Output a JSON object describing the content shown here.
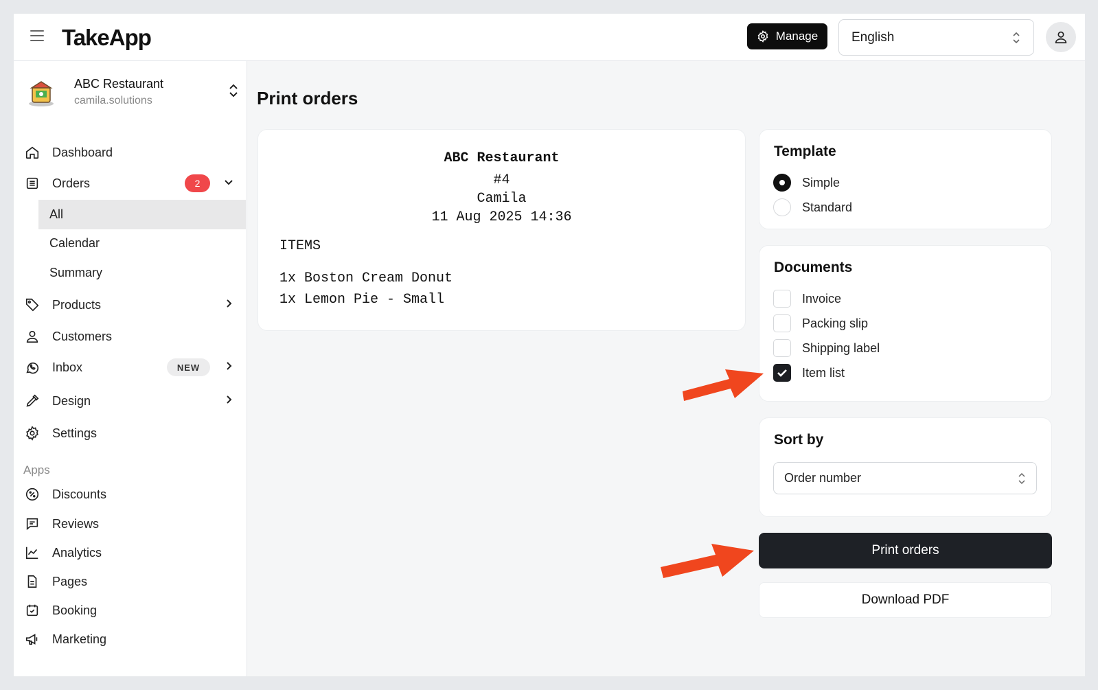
{
  "header": {
    "brand": "TakeApp",
    "manage_label": "Manage",
    "language_value": "English"
  },
  "store": {
    "name": "ABC Restaurant",
    "domain": "camila.solutions"
  },
  "nav": {
    "dashboard": "Dashboard",
    "orders": "Orders",
    "orders_badge": "2",
    "orders_sub": [
      "All",
      "Calendar",
      "Summary"
    ],
    "products": "Products",
    "customers": "Customers",
    "inbox": "Inbox",
    "inbox_badge": "NEW",
    "design": "Design",
    "settings": "Settings"
  },
  "apps": {
    "label": "Apps",
    "items": [
      "Discounts",
      "Reviews",
      "Analytics",
      "Pages",
      "Booking",
      "Marketing"
    ]
  },
  "main": {
    "title": "Print orders"
  },
  "receipt": {
    "store": "ABC Restaurant",
    "order_no": "#4",
    "customer": "Camila",
    "datetime": "11 Aug 2025 14:36",
    "items_header": "ITEMS",
    "items": [
      "1x Boston Cream Donut",
      "1x Lemon Pie - Small"
    ]
  },
  "template": {
    "title": "Template",
    "options": [
      "Simple",
      "Standard"
    ],
    "selected": "Simple"
  },
  "documents": {
    "title": "Documents",
    "options": [
      "Invoice",
      "Packing slip",
      "Shipping label",
      "Item list"
    ],
    "checked": [
      "Item list"
    ]
  },
  "sort": {
    "title": "Sort by",
    "value": "Order number"
  },
  "actions": {
    "print": "Print orders",
    "download": "Download PDF"
  },
  "colors": {
    "accent_arrow": "#f0461e",
    "badge_red": "#f0474a",
    "dark_button": "#1e2126"
  }
}
